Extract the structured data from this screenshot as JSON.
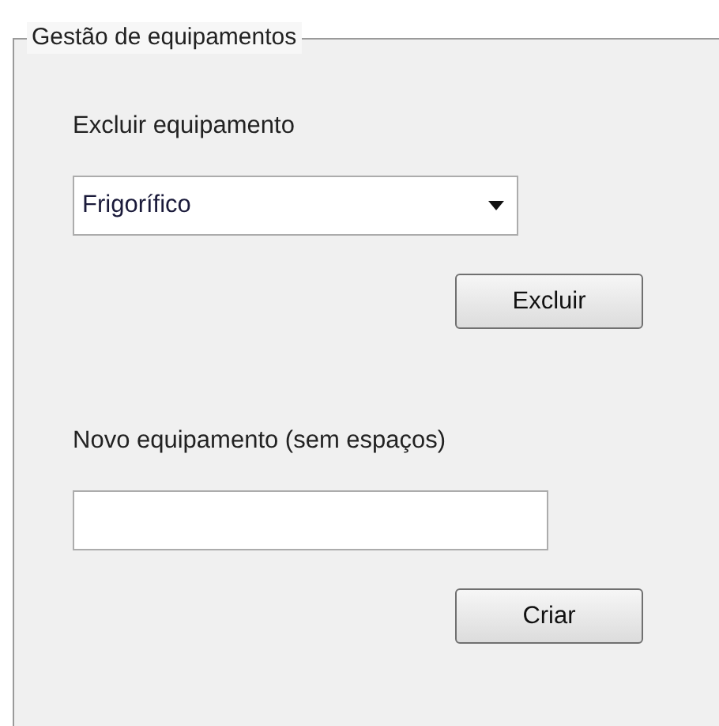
{
  "panel": {
    "title": "Gestão de equipamentos"
  },
  "delete_section": {
    "label": "Excluir equipamento",
    "dropdown": {
      "value": "Frigorífico"
    },
    "button": "Excluir"
  },
  "create_section": {
    "label": "Novo equipamento (sem espaços)",
    "button": "Criar"
  }
}
